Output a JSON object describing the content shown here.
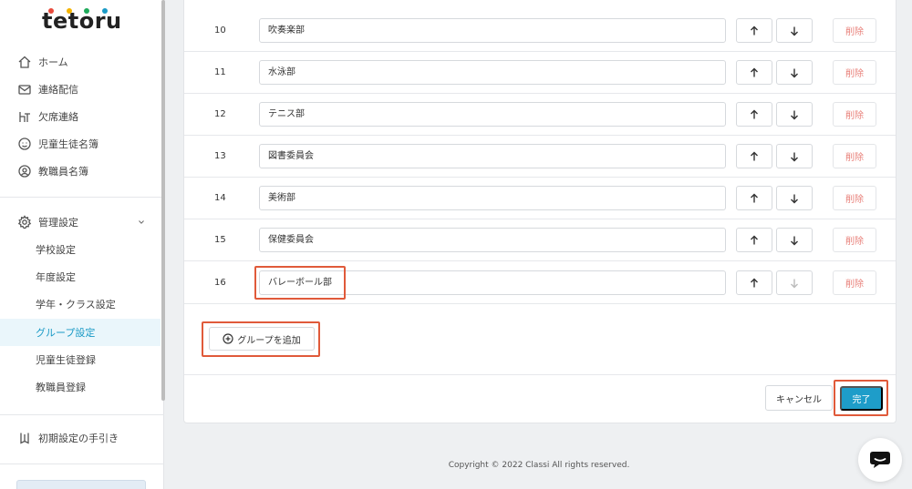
{
  "brand": {
    "logo_text": "tetoru",
    "dot_colors": [
      "#e94b3c",
      "#f5b400",
      "#1eaa5a",
      "#1a9ac6"
    ]
  },
  "sidebar": {
    "nav": [
      {
        "label": "ホーム",
        "icon": "home-icon"
      },
      {
        "label": "連絡配信",
        "icon": "mail-icon"
      },
      {
        "label": "欠席連絡",
        "icon": "desk-icon"
      },
      {
        "label": "児童生徒名簿",
        "icon": "student-icon"
      },
      {
        "label": "教職員名簿",
        "icon": "teacher-icon"
      }
    ],
    "admin": {
      "label": "管理設定",
      "icon": "gear-icon",
      "items": [
        {
          "label": "学校設定"
        },
        {
          "label": "年度設定"
        },
        {
          "label": "学年・クラス設定"
        },
        {
          "label": "グループ設定"
        },
        {
          "label": "児童生徒登録"
        },
        {
          "label": "教職員登録"
        }
      ],
      "active_index": 3
    },
    "guide": {
      "label": "初期設定の手引き",
      "icon": "book-icon"
    }
  },
  "groups": {
    "rows": [
      {
        "number": "10",
        "name": "吹奏楽部"
      },
      {
        "number": "11",
        "name": "水泳部"
      },
      {
        "number": "12",
        "name": "テニス部"
      },
      {
        "number": "13",
        "name": "図書委員会"
      },
      {
        "number": "14",
        "name": "美術部"
      },
      {
        "number": "15",
        "name": "保健委員会"
      },
      {
        "number": "16",
        "name": "バレーボール部"
      }
    ],
    "delete_label": "削除",
    "add_label": "グループを追加"
  },
  "actions": {
    "cancel_label": "キャンセル",
    "done_label": "完了"
  },
  "footer": {
    "copyright": "Copyright © 2022 Classi All rights reserved."
  },
  "colors": {
    "accent": "#1e9dc9",
    "highlight": "#e05a3a",
    "delete_text": "#e8807a"
  }
}
